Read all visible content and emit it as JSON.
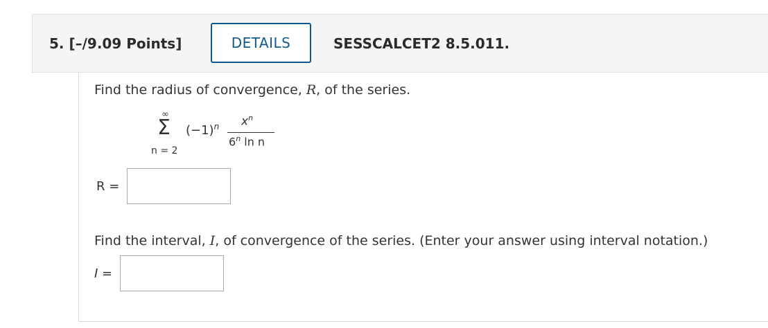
{
  "header": {
    "question_points": "5.  [–/9.09 Points]",
    "details_label": "DETAILS",
    "question_id": "SESSCALCET2 8.5.011."
  },
  "part1": {
    "prompt_before": "Find the radius of convergence, ",
    "prompt_var": "R",
    "prompt_after": ", of the series.",
    "answer_label": "R =",
    "answer_value": ""
  },
  "series": {
    "upper_limit": "∞",
    "sigma": "Σ",
    "lower_limit": "n = 2",
    "sign_factor": "(−1)",
    "sign_exponent": "n",
    "numerator_base": "x",
    "numerator_exponent": "n",
    "denominator_base": "6",
    "denominator_exponent": "n",
    "denominator_rest": " ln n"
  },
  "part2": {
    "prompt_before": "Find the interval, ",
    "prompt_var": "I",
    "prompt_after": ", of convergence of the series. (Enter your answer using interval notation.)",
    "answer_label": "I =",
    "answer_value": ""
  }
}
